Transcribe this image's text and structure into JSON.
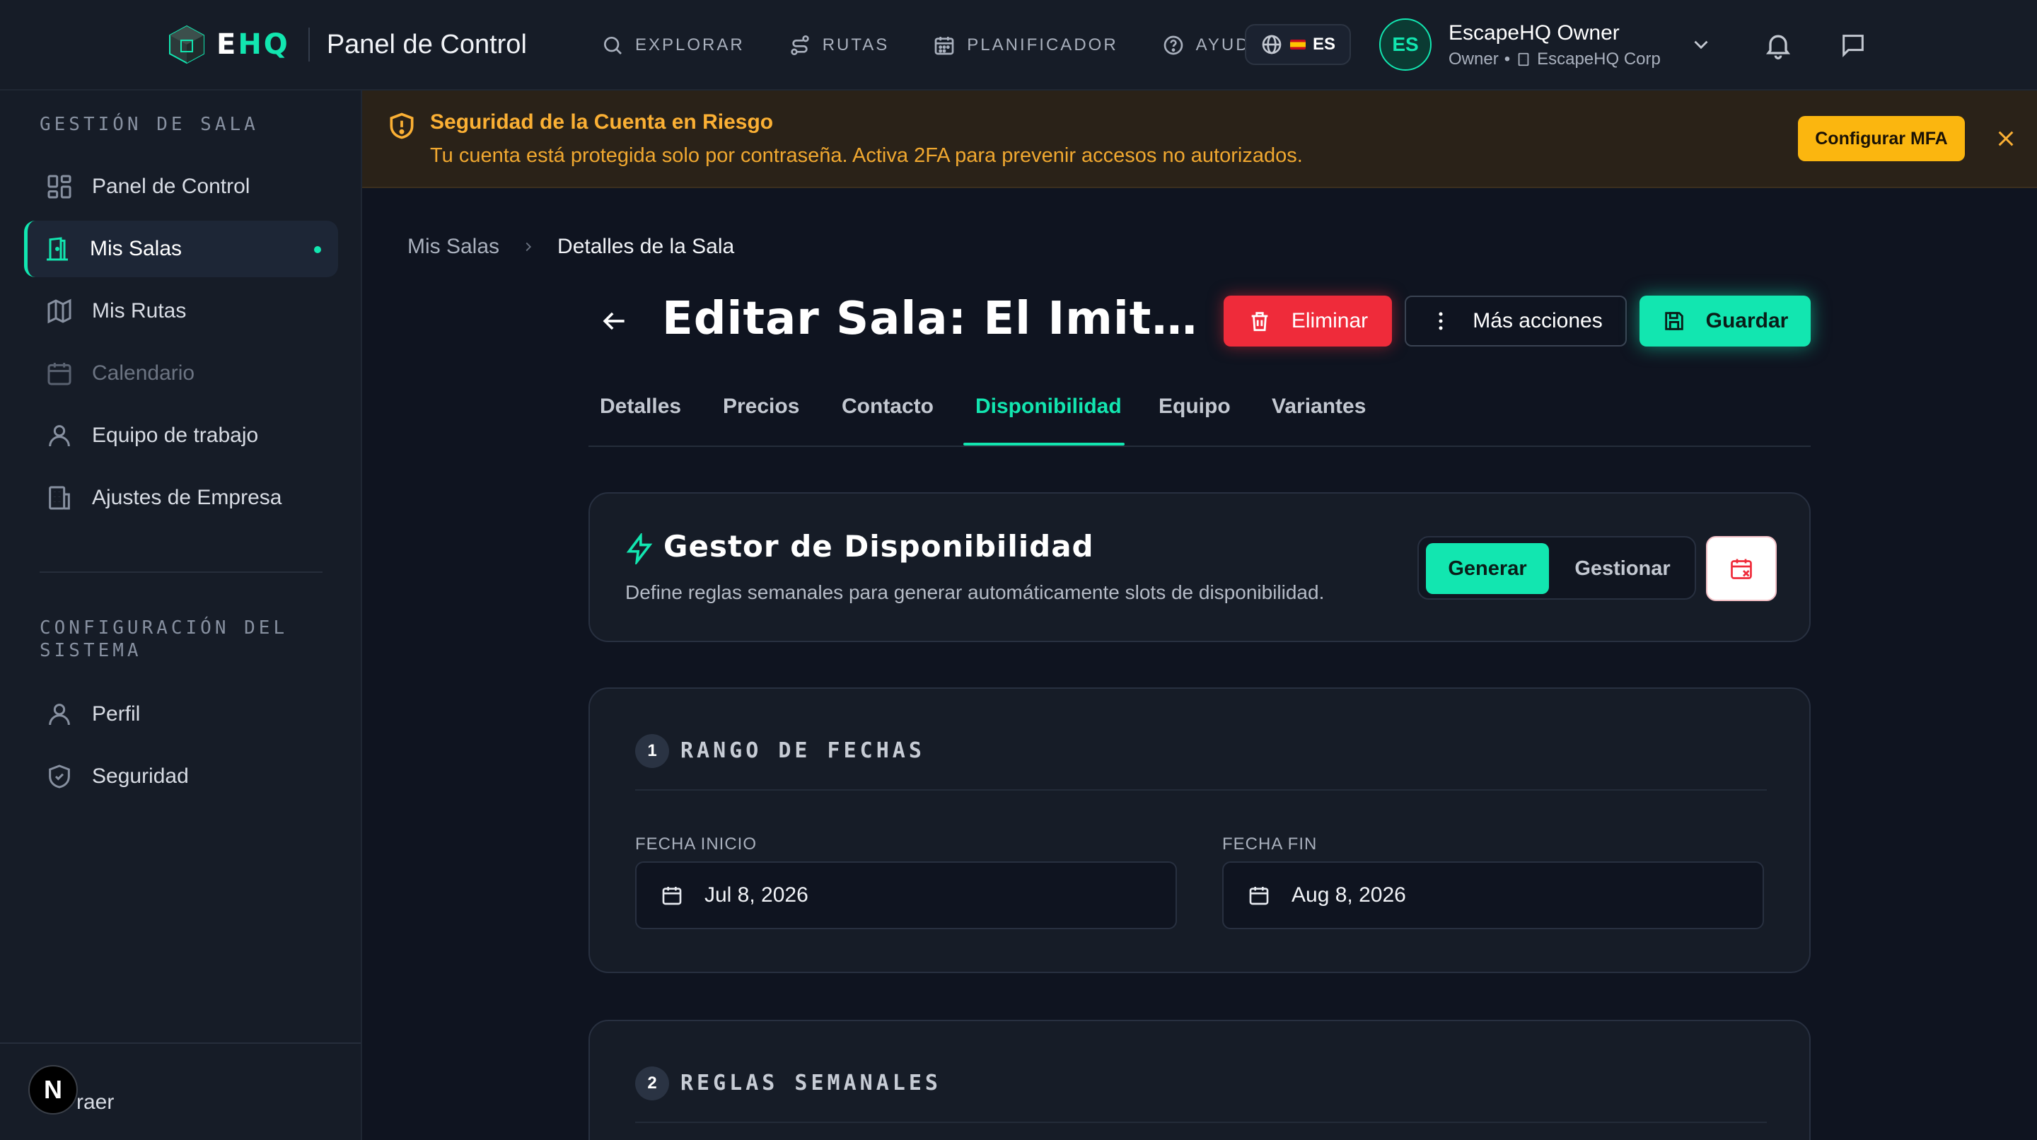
{
  "brand": {
    "logo_text_e": "E",
    "logo_text_hq": "HQ",
    "title": "Panel de Control"
  },
  "topnav": [
    {
      "label": "EXPLORAR",
      "icon": "search-icon"
    },
    {
      "label": "RUTAS",
      "icon": "route-icon"
    },
    {
      "label": "PLANIFICADOR",
      "icon": "calendar-icon"
    },
    {
      "label": "AYUDA",
      "icon": "help-icon"
    }
  ],
  "language": {
    "code": "ES",
    "icon": "globe-icon"
  },
  "user": {
    "initials": "ES",
    "name": "EscapeHQ Owner",
    "role": "Owner",
    "separator": "•",
    "company": "EscapeHQ Corp"
  },
  "sidebar": {
    "section1": "GESTIÓN DE SALA",
    "items1": [
      {
        "label": "Panel de Control",
        "icon": "dashboard-icon"
      },
      {
        "label": "Mis Salas",
        "icon": "door-icon"
      },
      {
        "label": "Mis Rutas",
        "icon": "map-icon"
      },
      {
        "label": "Calendario",
        "icon": "calendar-icon"
      },
      {
        "label": "Equipo de trabajo",
        "icon": "user-icon"
      },
      {
        "label": "Ajustes de Empresa",
        "icon": "building-icon"
      }
    ],
    "section2": "CONFIGURACIÓN DEL SISTEMA",
    "items2": [
      {
        "label": "Perfil",
        "icon": "user-icon"
      },
      {
        "label": "Seguridad",
        "icon": "shield-icon"
      }
    ],
    "collapse_label": "raer",
    "next_badge": "N"
  },
  "alert": {
    "title": "Seguridad de la Cuenta en Riesgo",
    "text": "Tu cuenta está protegida solo por contraseña. Activa 2FA para prevenir accesos no autorizados.",
    "button": "Configurar MFA",
    "accent": "#fbb034"
  },
  "breadcrumb": {
    "parent": "Mis Salas",
    "current": "Detalles de la Sala"
  },
  "page": {
    "title": "Editar Sala: El Imitad...",
    "delete_label": "Eliminar",
    "more_label": "Más acciones",
    "save_label": "Guardar"
  },
  "tabs": [
    "Detalles",
    "Precios",
    "Contacto",
    "Disponibilidad",
    "Equipo",
    "Variantes"
  ],
  "active_tab": "Disponibilidad",
  "availability": {
    "title": "Gestor de Disponibilidad",
    "description": "Define reglas semanales para generar automáticamente slots de disponibilidad.",
    "mode_generate": "Generar",
    "mode_manage": "Gestionar"
  },
  "date_range": {
    "step": "1",
    "title": "RANGO DE FECHAS",
    "start_label": "FECHA INICIO",
    "start_value": "Jul 8, 2026",
    "end_label": "FECHA FIN",
    "end_value": "Aug 8, 2026"
  },
  "weekly_rules": {
    "step": "2",
    "title": "REGLAS SEMANALES"
  },
  "colors": {
    "accent": "#12e6b0",
    "danger": "#ef2b3a",
    "warning": "#fbb60f",
    "background": "#0f1420"
  }
}
